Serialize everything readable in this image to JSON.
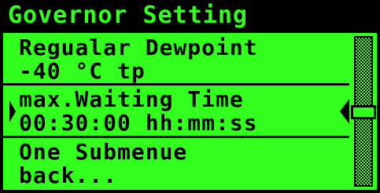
{
  "header": {
    "title": "Governor Setting"
  },
  "menu": {
    "items": [
      {
        "line1": "Regualar Dewpoint",
        "line2": "-40 °C tp",
        "selected": false
      },
      {
        "line1": "max.Waiting Time",
        "line2": "00:30:00 hh:mm:ss",
        "selected": true
      },
      {
        "line1": "One Submenue",
        "line2": "back...",
        "selected": false
      }
    ]
  },
  "scrollbar": {
    "position": 0.5
  },
  "colors": {
    "screen_green": "#33ff1f",
    "text": "#000000"
  }
}
